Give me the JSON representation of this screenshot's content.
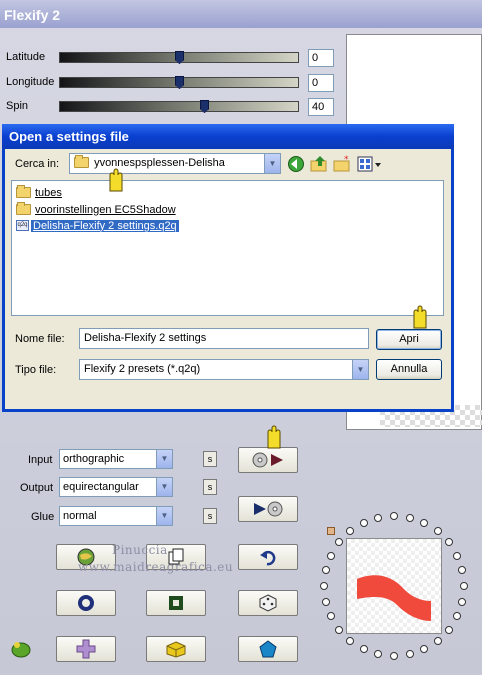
{
  "app": {
    "title": "Flexify 2",
    "sliders": [
      {
        "label": "Latitude",
        "value": "0",
        "thumb_fraction": 0.5
      },
      {
        "label": "Longitude",
        "value": "0",
        "thumb_fraction": 0.5
      },
      {
        "label": "Spin",
        "value": "40",
        "thumb_fraction": 0.61
      }
    ],
    "controls": {
      "input": {
        "label": "Input",
        "value": "orthographic"
      },
      "output": {
        "label": "Output",
        "value": "equirectangular"
      },
      "glue": {
        "label": "Glue",
        "value": "normal"
      },
      "s_label": "s"
    },
    "watermark": {
      "line1": "Pinuccia",
      "line2": "www.maidreagrafica.eu"
    }
  },
  "dialog": {
    "title": "Open a settings file",
    "look_in_label": "Cerca in:",
    "look_in_value": "yvonnespsplessen-Delisha",
    "files": [
      {
        "name": "tubes",
        "kind": "folder"
      },
      {
        "name": "voorinstellingen EC5Shadow",
        "kind": "folder"
      },
      {
        "name": "Delisha-Flexify 2 settings.q2q",
        "kind": "file",
        "selected": true
      }
    ],
    "filename_label": "Nome file:",
    "filename_value": "Delisha-Flexify 2 settings",
    "filetype_label": "Tipo file:",
    "filetype_value": "Flexify 2 presets (*.q2q)",
    "open_button": "Apri",
    "cancel_button": "Annulla"
  },
  "colors": {
    "dialog_title": "#0a3fcf",
    "selection": "#316ac5",
    "shape_red": "#f04a3c"
  }
}
